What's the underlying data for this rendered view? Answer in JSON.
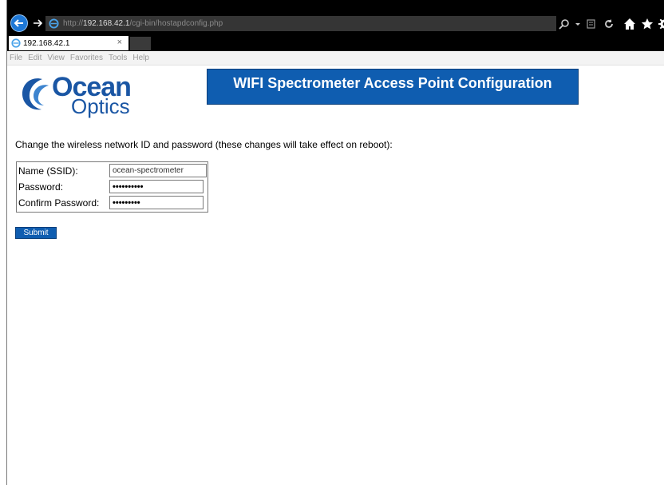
{
  "browser": {
    "address": {
      "scheme": "http://",
      "host": "192.168.42.1",
      "path": "/cgi-bin/hostapdconfig.php"
    },
    "tab": {
      "title": "192.168.42.1",
      "close_glyph": "×"
    },
    "toolbar_icons": [
      "search-icon",
      "dropdown-icon",
      "compatibility-icon",
      "refresh-icon",
      "home-icon",
      "favorites-star-icon",
      "gear-icon"
    ],
    "menu": [
      "File",
      "Edit",
      "View",
      "Favorites",
      "Tools",
      "Help"
    ]
  },
  "page": {
    "logo": {
      "line1": "Ocean",
      "line2": "Optics"
    },
    "banner_title": "WIFI Spectrometer Access Point Configuration",
    "intro": "Change the wireless network ID and password (these changes will take effect on reboot):",
    "form": {
      "ssid_label": "Name (SSID):",
      "ssid_value": "ocean-spectrometer",
      "password_label": "Password:",
      "password_value": "••••••••••",
      "confirm_label": "Confirm Password:",
      "confirm_value": "•••••••••",
      "submit_label": "Submit"
    }
  },
  "colors": {
    "accent": "#0f5db0",
    "chrome": "#000000"
  }
}
